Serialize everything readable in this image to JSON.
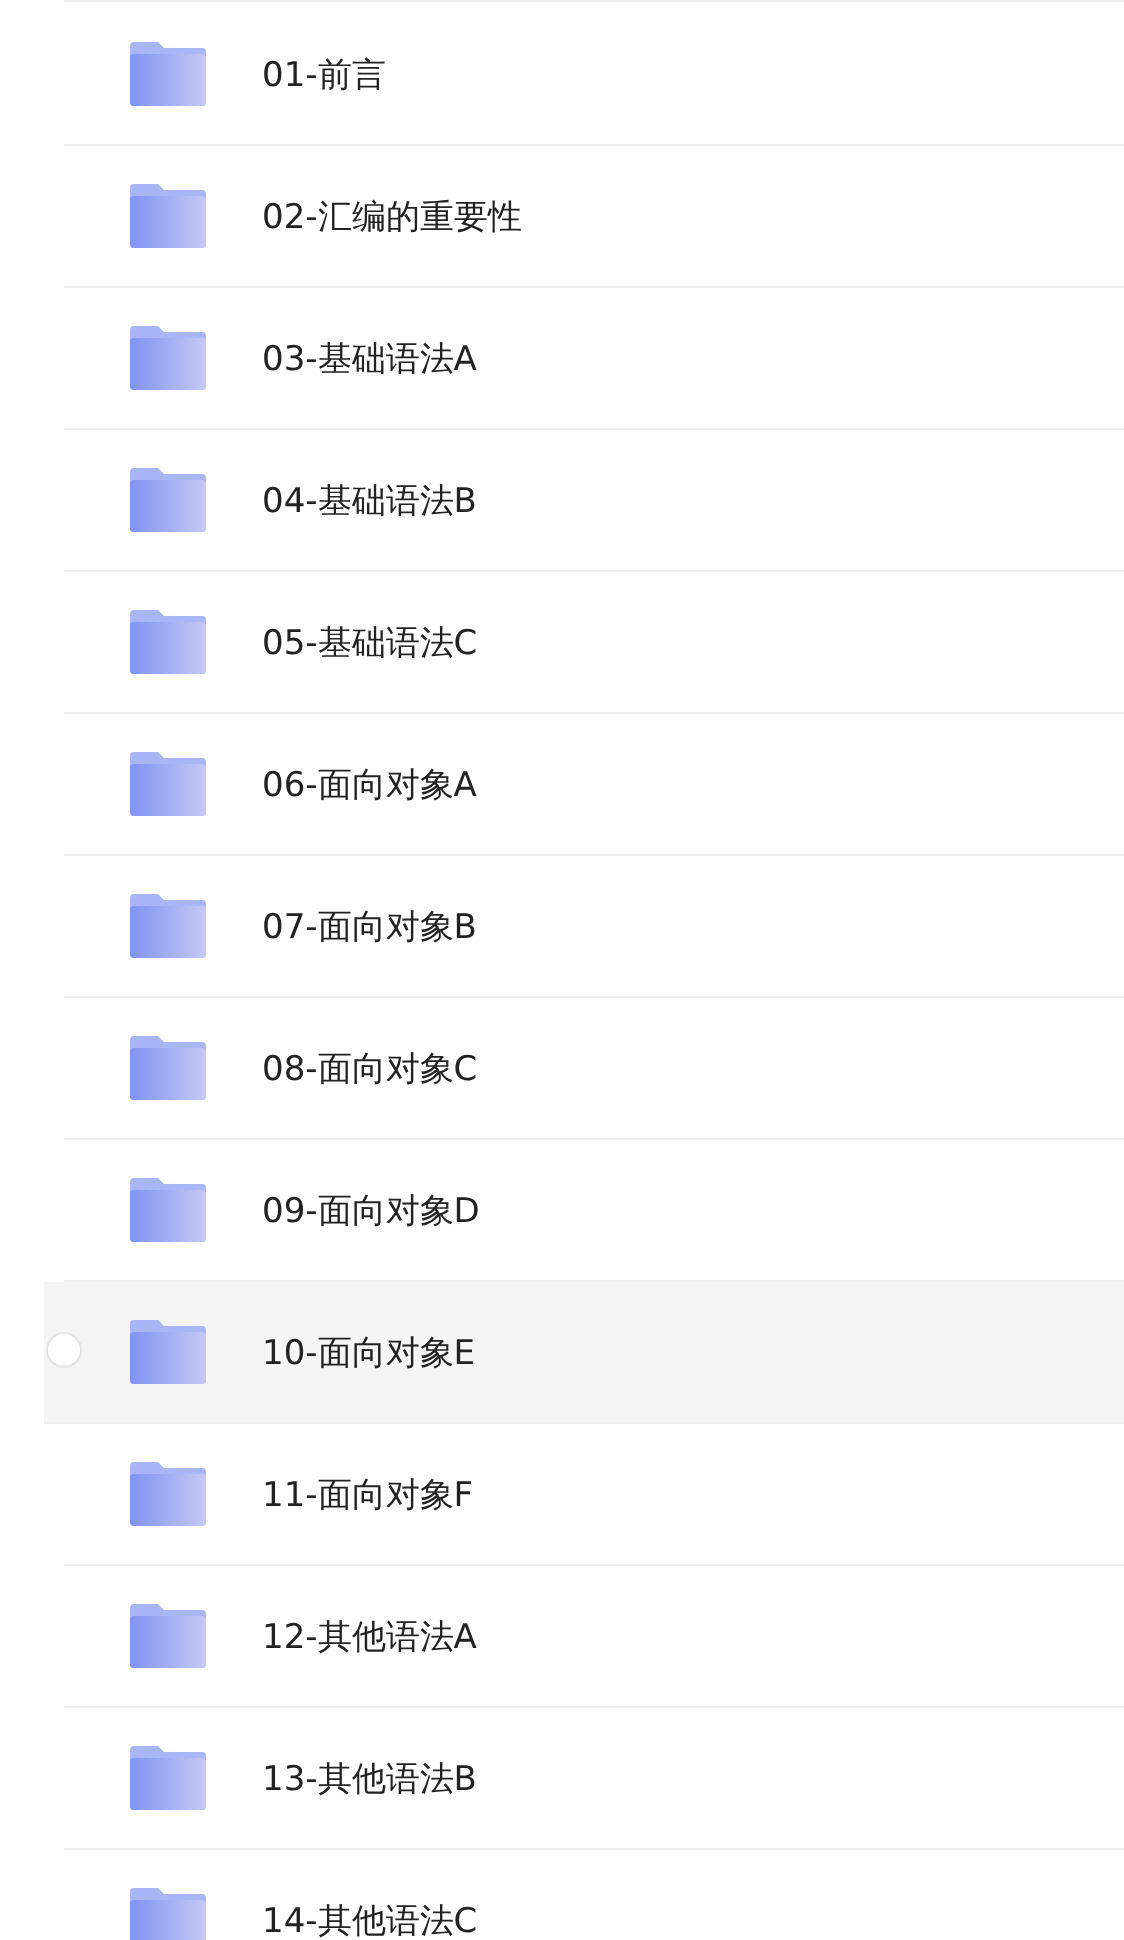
{
  "folders": [
    {
      "name": "01-前言",
      "hovered": false
    },
    {
      "name": "02-汇编的重要性",
      "hovered": false
    },
    {
      "name": "03-基础语法A",
      "hovered": false
    },
    {
      "name": "04-基础语法B",
      "hovered": false
    },
    {
      "name": "05-基础语法C",
      "hovered": false
    },
    {
      "name": "06-面向对象A",
      "hovered": false
    },
    {
      "name": "07-面向对象B",
      "hovered": false
    },
    {
      "name": "08-面向对象C",
      "hovered": false
    },
    {
      "name": "09-面向对象D",
      "hovered": false
    },
    {
      "name": "10-面向对象E",
      "hovered": true
    },
    {
      "name": "11-面向对象F",
      "hovered": false
    },
    {
      "name": "12-其他语法A",
      "hovered": false
    },
    {
      "name": "13-其他语法B",
      "hovered": false
    },
    {
      "name": "14-其他语法C",
      "hovered": false
    }
  ]
}
